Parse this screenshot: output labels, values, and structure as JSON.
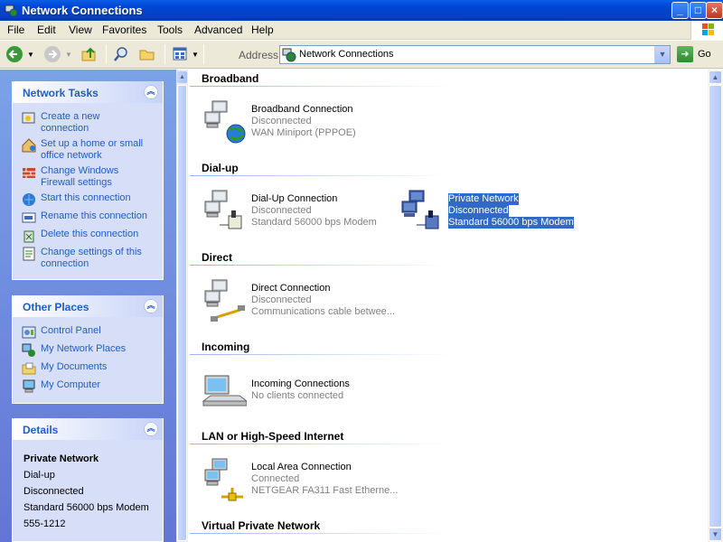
{
  "window": {
    "title": "Network Connections"
  },
  "menu": [
    "File",
    "Edit",
    "View",
    "Favorites",
    "Tools",
    "Advanced",
    "Help"
  ],
  "toolbar": {
    "address_label": "Address",
    "address_value": "Network Connections",
    "go_label": "Go"
  },
  "tasks": {
    "title": "Network Tasks",
    "items": [
      "Create a new connection",
      "Set up a home or small office network",
      "Change Windows Firewall settings",
      "Start this connection",
      "Rename this connection",
      "Delete this connection",
      "Change settings of this connection"
    ]
  },
  "places": {
    "title": "Other Places",
    "items": [
      "Control Panel",
      "My Network Places",
      "My Documents",
      "My Computer"
    ]
  },
  "details": {
    "title": "Details",
    "name": "Private Network",
    "type": "Dial-up",
    "status": "Disconnected",
    "device": "Standard 56000 bps Modem",
    "phone": "555-1212"
  },
  "groups": {
    "broadband": {
      "title": "Broadband",
      "items": [
        {
          "name": "Broadband Connection",
          "status": "Disconnected",
          "device": "WAN Miniport (PPPOE)"
        }
      ]
    },
    "dialup": {
      "title": "Dial-up",
      "items": [
        {
          "name": "Dial-Up Connection",
          "status": "Disconnected",
          "device": "Standard 56000 bps Modem"
        },
        {
          "name": "Private Network",
          "status": "Disconnected",
          "device": "Standard 56000 bps Modem"
        }
      ]
    },
    "direct": {
      "title": "Direct",
      "items": [
        {
          "name": "Direct Connection",
          "status": "Disconnected",
          "device": "Communications cable betwee..."
        }
      ]
    },
    "incoming": {
      "title": "Incoming",
      "items": [
        {
          "name": "Incoming Connections",
          "status": "No clients connected"
        }
      ]
    },
    "lan": {
      "title": "LAN or High-Speed Internet",
      "items": [
        {
          "name": "Local Area Connection",
          "status": "Connected",
          "device": "NETGEAR FA311 Fast Etherne..."
        }
      ]
    },
    "vpn": {
      "title": "Virtual Private Network"
    }
  },
  "colors": {
    "titlebar": "#0054e3",
    "task_link": "#215dc6",
    "selection": "#316ac5",
    "panel": "#6375d6"
  }
}
